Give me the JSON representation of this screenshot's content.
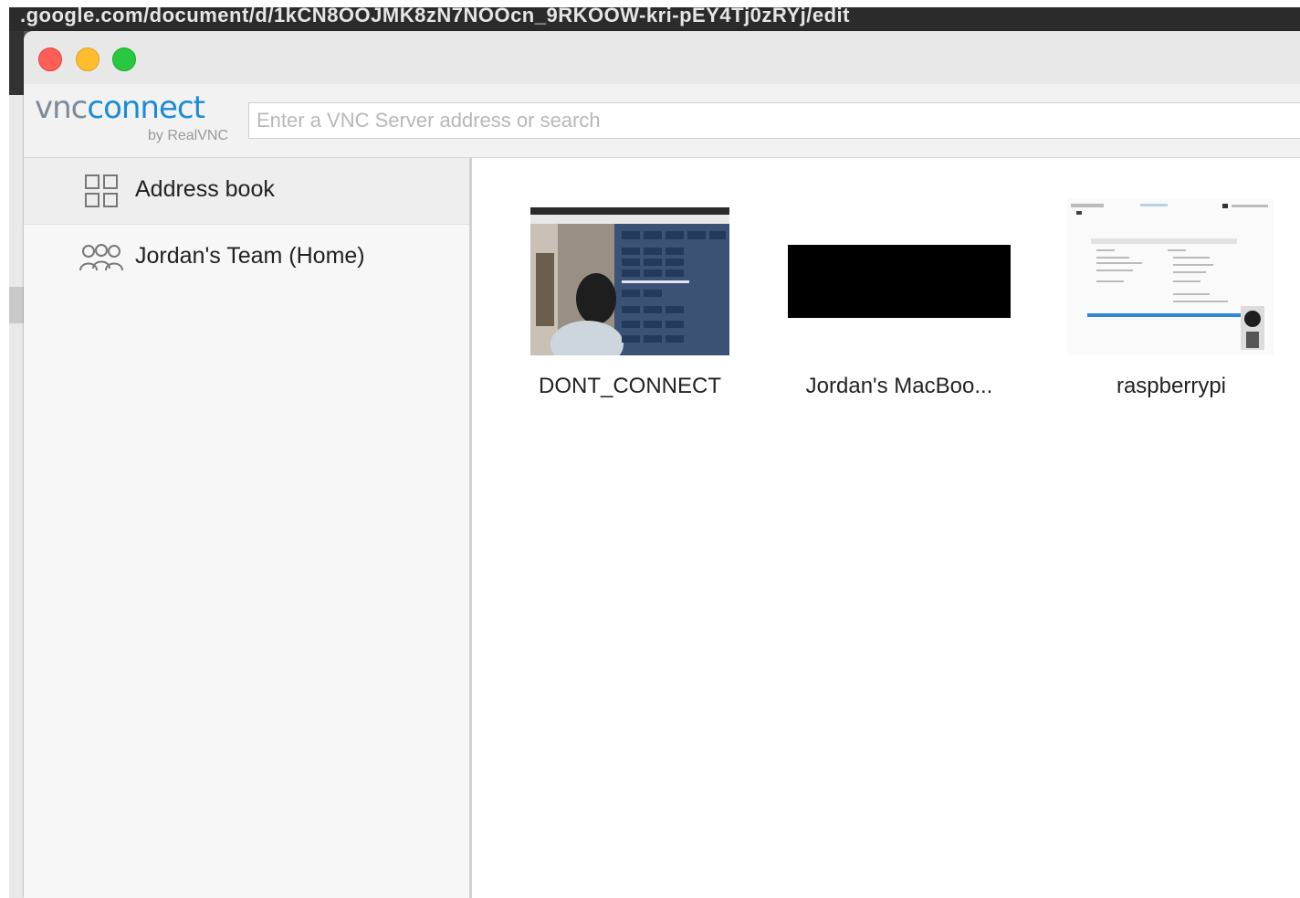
{
  "background": {
    "url_fragment": ".google.com/document/d/1kCN8OOJMK8zN7NOOcn_9RKOOW-kri-pEY4Tj0zRYj/edit"
  },
  "window": {
    "traffic_lights": [
      "close",
      "minimize",
      "zoom"
    ]
  },
  "toolbar": {
    "logo_vnc": "vnc",
    "logo_connect": "connect",
    "logo_byline": "by RealVNC",
    "search_placeholder": "Enter a VNC Server address or search",
    "search_value": ""
  },
  "sidebar": {
    "items": [
      {
        "label": "Address book",
        "icon": "grid-icon",
        "selected": true
      },
      {
        "label": "Jordan's Team (Home)",
        "icon": "team-icon",
        "selected": false
      }
    ]
  },
  "computers": [
    {
      "name": "DONT_CONNECT",
      "thumbnail": "webcam-desktop"
    },
    {
      "name": "Jordan's MacBoo...",
      "thumbnail": "black-screen"
    },
    {
      "name": "raspberrypi",
      "thumbnail": "light-desktop"
    }
  ],
  "colors": {
    "brand_blue": "#1a8cd8",
    "brand_gray": "#7d8b99",
    "close": "#fe5f57",
    "minimize": "#febc2e",
    "zoom": "#28c840"
  }
}
